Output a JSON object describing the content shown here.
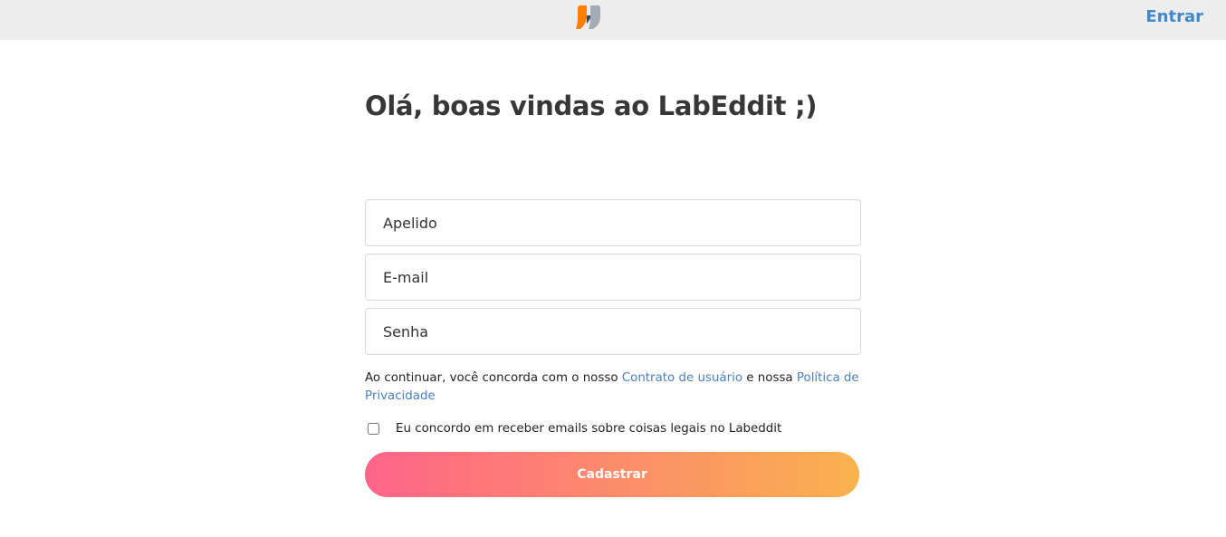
{
  "header": {
    "logo_icon": "labeddit-logo-icon",
    "login_label": "Entrar",
    "colors": {
      "bar": "#ededed",
      "link": "#4088cb",
      "logo_orange": "#fe7e02",
      "logo_gray": "#a3acb4"
    }
  },
  "main": {
    "title": "Olá, boas vindas ao LabEddit ;)",
    "fields": {
      "nickname_placeholder": "Apelido",
      "email_placeholder": "E-mail",
      "password_placeholder": "Senha"
    },
    "terms": {
      "prefix": "Ao continuar, você concorda com o nosso ",
      "user_agreement_link": "Contrato de usuário",
      "middle": " e nossa ",
      "privacy_link": "Política de Privacidade"
    },
    "newsletter_label": "Eu concordo em receber emails sobre coisas legais no Labeddit",
    "submit_label": "Cadastrar",
    "colors": {
      "gradient_start": "#ff6489",
      "gradient_end": "#f9b24e",
      "link": "#4a7fc0"
    }
  }
}
